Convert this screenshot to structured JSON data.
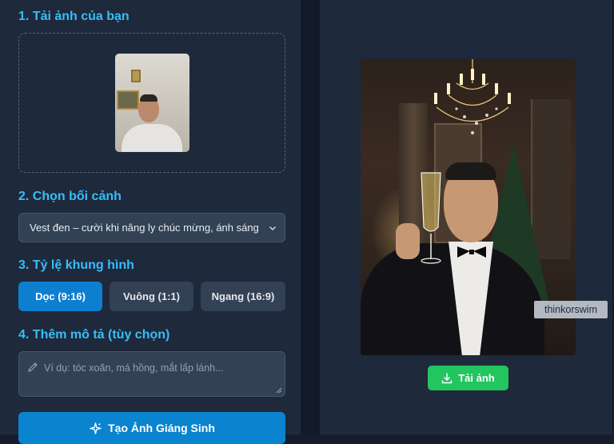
{
  "sections": {
    "upload_title": "1. Tải ảnh của bạn",
    "scene_title": "2. Chọn bối cảnh",
    "ratio_title": "3. Tỷ lệ khung hình",
    "desc_title": "4. Thêm mô tả (tùy chọn)"
  },
  "scene_select": {
    "value": "Vest đen – cười khi nâng ly chúc mừng, ánh sáng phòng tiệc"
  },
  "ratios": [
    {
      "label": "Dọc (9:16)",
      "active": true
    },
    {
      "label": "Vuông (1:1)",
      "active": false
    },
    {
      "label": "Ngang (16:9)",
      "active": false
    }
  ],
  "description": {
    "placeholder": "Ví dụ: tóc xoăn, má hồng, mắt lấp lánh..."
  },
  "generate_label": "Tạo Ảnh Giáng Sinh",
  "download_label": "Tải ảnh",
  "watermark": "thinkorswim",
  "colors": {
    "accent": "#38bdf8",
    "primary": "#0e7fd0",
    "success": "#22c55e",
    "panel": "#1e293b"
  },
  "icons": {
    "select": "chevron-down-icon",
    "description": "pencil-icon",
    "generate": "sparkles-icon",
    "download": "download-icon"
  }
}
